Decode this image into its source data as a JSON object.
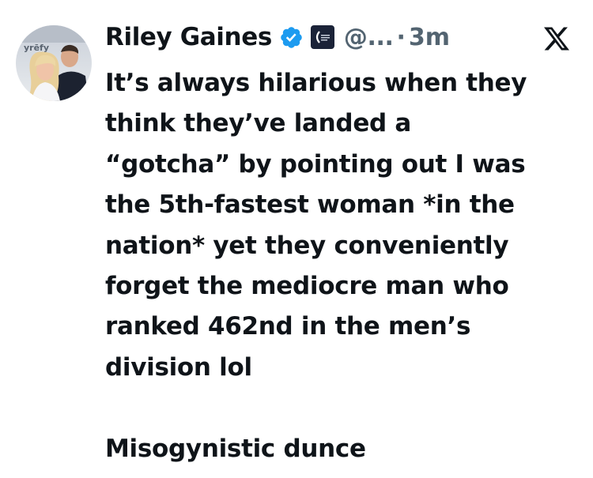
{
  "tweet": {
    "author_name": "Riley Gaines",
    "handle": "@...",
    "separator": "·",
    "timestamp": "3m",
    "avatar_text": "yrēfy",
    "body": "It’s always hilarious when they\nthink they’ve landed a\n“gotcha” by pointing out I was\nthe 5th-fastest woman *in the\nnation* yet they conveniently\nforget the mediocre man who\nranked 462nd in the men’s\ndivision lol\n\nMisogynistic dunce",
    "icons": {
      "verified": "verified-badge-icon",
      "affiliate": "affiliate-badge-icon",
      "platform": "x-logo-icon"
    },
    "colors": {
      "verified": "#1d9bf0",
      "secondary_text": "#536471",
      "text": "#0f1419"
    }
  }
}
